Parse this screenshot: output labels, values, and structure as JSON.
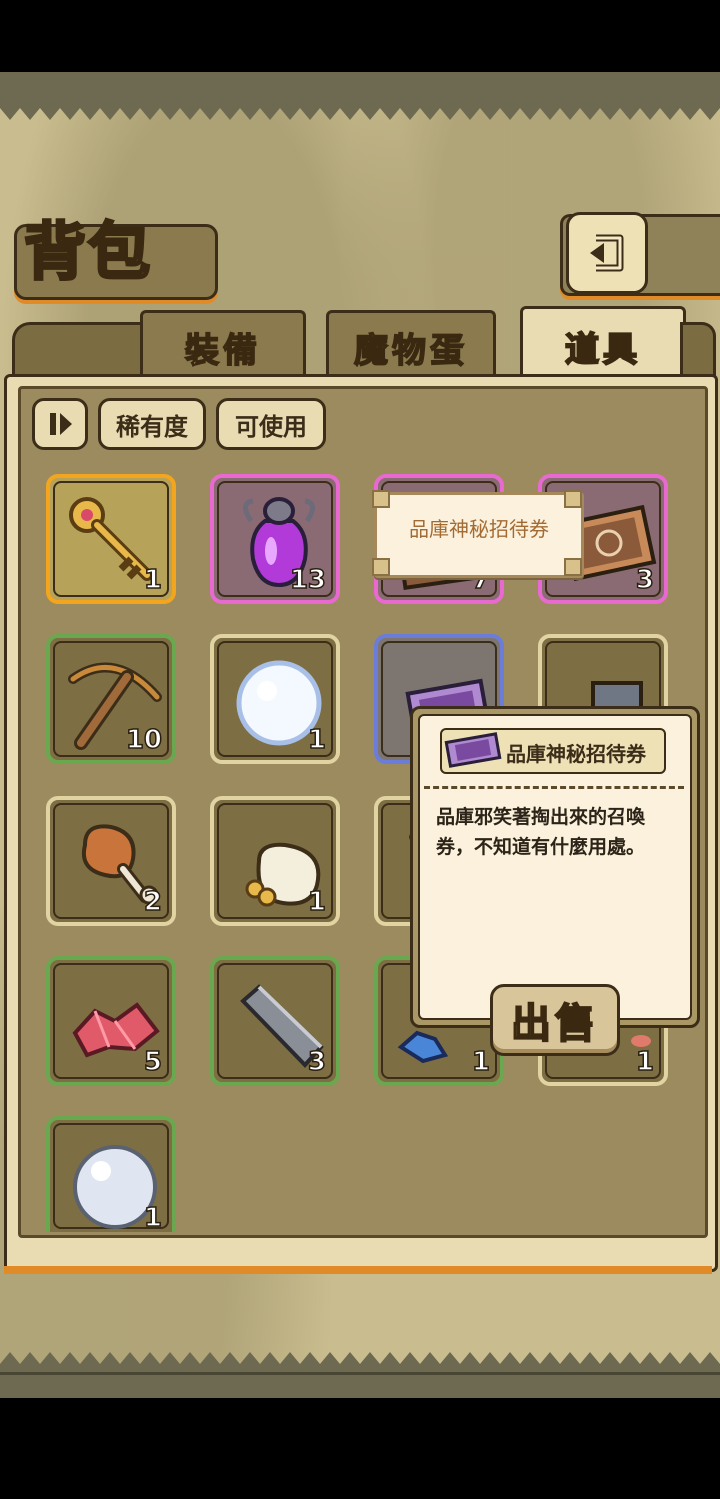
{
  "screen": {
    "title": "背包"
  },
  "tabs": [
    {
      "label": "裝備",
      "active": false
    },
    {
      "label": "魔物蛋",
      "active": false
    },
    {
      "label": "道具",
      "active": true
    }
  ],
  "filters": {
    "rarity_label": "稀有度",
    "usable_label": "可使用"
  },
  "items": [
    {
      "name": "golden-key",
      "rarity": "gold",
      "count": "1"
    },
    {
      "name": "purple-potion",
      "rarity": "purple",
      "count": "13"
    },
    {
      "name": "mystery-ticket",
      "rarity": "purple",
      "count": "7"
    },
    {
      "name": "summon-card",
      "rarity": "purple",
      "count": "3"
    },
    {
      "name": "pickaxe",
      "rarity": "green",
      "count": "10"
    },
    {
      "name": "snowball",
      "rarity": "tan",
      "count": "1"
    },
    {
      "name": "invitation-ticket",
      "rarity": "blue",
      "count": ""
    },
    {
      "name": "anvil",
      "rarity": "tan",
      "count": ""
    },
    {
      "name": "chicken-leg",
      "rarity": "tan",
      "count": "2"
    },
    {
      "name": "money-bag",
      "rarity": "tan",
      "count": "1"
    },
    {
      "name": "shovel",
      "rarity": "tan",
      "count": ""
    },
    {
      "name": "red-crystal",
      "rarity": "green",
      "count": "5"
    },
    {
      "name": "iron-ingot",
      "rarity": "green",
      "count": "3"
    },
    {
      "name": "blue-crystal",
      "rarity": "green",
      "count": "1"
    },
    {
      "name": "meat",
      "rarity": "tan",
      "count": "1"
    },
    {
      "name": "pearl",
      "rarity": "green",
      "count": "1"
    }
  ],
  "tooltip": {
    "text": "品庫神秘招待券"
  },
  "detail": {
    "name": "品庫神秘招待券",
    "description": "品庫邪笑著掏出來的召喚券，不知道有什麼用處。",
    "sell_label": "出售"
  }
}
